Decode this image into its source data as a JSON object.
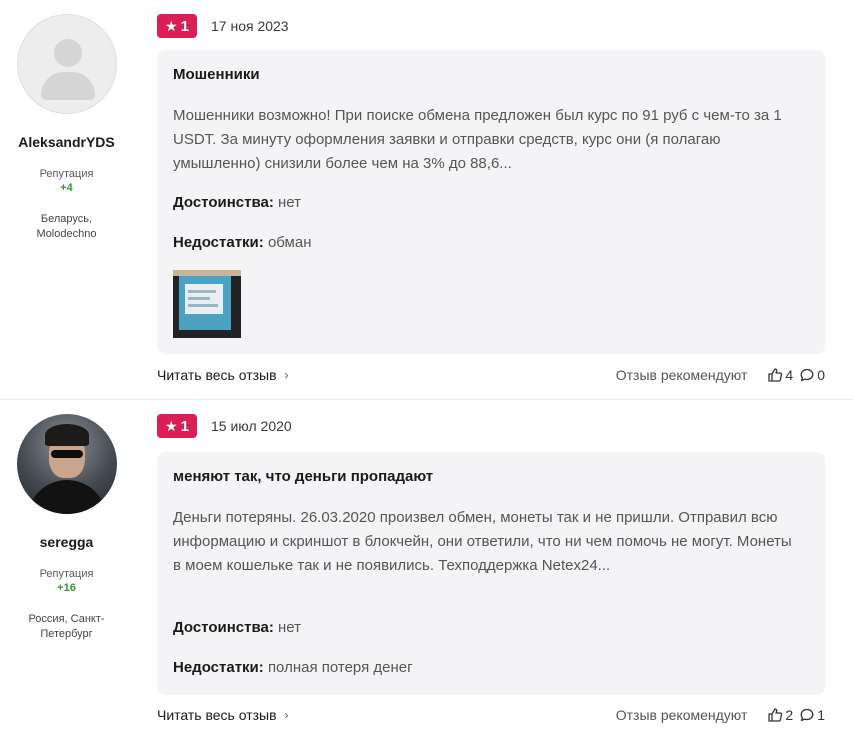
{
  "reviews": [
    {
      "author": {
        "name": "AleksandrYDS",
        "reputation_label": "Репутация",
        "reputation": "+4",
        "location": "Беларусь, Molodechno"
      },
      "rating": "1",
      "date": "17 ноя 2023",
      "title": "Мошенники",
      "text": "Мошенники возможно! При поиске обмена предложен был курс по 91 руб с чем-то за 1 USDT. За минуту оформления заявки и отправки средств, курс они (я полагаю умышленно) снизили более чем на 3% до 88,6...",
      "pros_label": "Достоинства:",
      "pros": "нет",
      "cons_label": "Недостатки:",
      "cons": "обман",
      "read_more": "Читать весь отзыв",
      "recommend_label": "Отзыв рекомендуют",
      "likes": "4",
      "comments": "0"
    },
    {
      "author": {
        "name": "seregga",
        "reputation_label": "Репутация",
        "reputation": "+16",
        "location": "Россия, Санкт-Петербург"
      },
      "rating": "1",
      "date": "15 июл 2020",
      "title": "меняют так, что деньги пропадают",
      "text": "Деньги потеряны. 26.03.2020 произвел обмен, монеты так и не пришли. Отправил всю информацию и скриншот в блокчейн, они ответили, что ни чем помочь не могут. Монеты в моем кошельке так и не появились. Техподдержка Netex24...",
      "pros_label": "Достоинства:",
      "pros": "нет",
      "cons_label": "Недостатки:",
      "cons": "полная потеря денег",
      "read_more": "Читать весь отзыв",
      "recommend_label": "Отзыв рекомендуют",
      "likes": "2",
      "comments": "1"
    }
  ],
  "icons": {
    "star": "star-icon",
    "chevron": "chevron-right-icon",
    "like": "thumbs-up-icon",
    "comment": "comment-icon"
  },
  "colors": {
    "rating_badge": "#d92056",
    "reputation": "#2e9b2e",
    "card_bg": "#f4f4f6"
  }
}
